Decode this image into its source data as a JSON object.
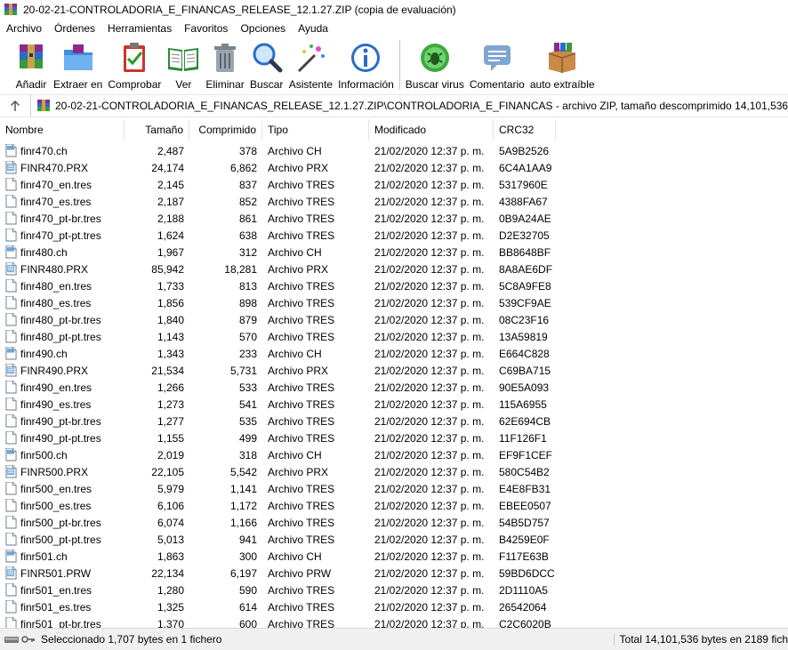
{
  "window": {
    "title": "20-02-21-CONTROLADORIA_E_FINANCAS_RELEASE_12.1.27.ZIP (copia de evaluación)"
  },
  "menu": [
    "Archivo",
    "Órdenes",
    "Herramientas",
    "Favoritos",
    "Opciones",
    "Ayuda"
  ],
  "toolbar": [
    {
      "label": "Añadir",
      "icon": "add-archive-icon"
    },
    {
      "label": "Extraer en",
      "icon": "extract-folder-icon"
    },
    {
      "label": "Comprobar",
      "icon": "test-clipboard-icon"
    },
    {
      "label": "Ver",
      "icon": "view-book-icon"
    },
    {
      "label": "Eliminar",
      "icon": "trash-icon"
    },
    {
      "label": "Buscar",
      "icon": "magnifier-icon"
    },
    {
      "label": "Asistente",
      "icon": "wizard-wand-icon"
    },
    {
      "label": "Información",
      "icon": "info-icon"
    },
    {
      "label": "Buscar virus",
      "icon": "virus-scan-icon"
    },
    {
      "label": "Comentario",
      "icon": "comment-icon"
    },
    {
      "label": "auto extraíble",
      "icon": "sfx-box-icon"
    }
  ],
  "address": {
    "path": "20-02-21-CONTROLADORIA_E_FINANCAS_RELEASE_12.1.27.ZIP\\CONTROLADORIA_E_FINANCAS - archivo ZIP, tamaño descomprimido 14,101,536 bytes"
  },
  "columns": {
    "name": "Nombre",
    "size": "Tamaño",
    "compressed": "Comprimido",
    "type": "Tipo",
    "modified": "Modificado",
    "crc": "CRC32"
  },
  "files": [
    {
      "name": "finr470.ch",
      "size": "2,487",
      "compressed": "378",
      "type": "Archivo CH",
      "modified": "21/02/2020 12:37 p. m.",
      "crc": "5A9B2526",
      "kind": "ch"
    },
    {
      "name": "FINR470.PRX",
      "size": "24,174",
      "compressed": "6,862",
      "type": "Archivo PRX",
      "modified": "21/02/2020 12:37 p. m.",
      "crc": "6C4A1AA9",
      "kind": "prx"
    },
    {
      "name": "finr470_en.tres",
      "size": "2,145",
      "compressed": "837",
      "type": "Archivo TRES",
      "modified": "21/02/2020 12:37 p. m.",
      "crc": "5317960E",
      "kind": "tres"
    },
    {
      "name": "finr470_es.tres",
      "size": "2,187",
      "compressed": "852",
      "type": "Archivo TRES",
      "modified": "21/02/2020 12:37 p. m.",
      "crc": "4388FA67",
      "kind": "tres"
    },
    {
      "name": "finr470_pt-br.tres",
      "size": "2,188",
      "compressed": "861",
      "type": "Archivo TRES",
      "modified": "21/02/2020 12:37 p. m.",
      "crc": "0B9A24AE",
      "kind": "tres"
    },
    {
      "name": "finr470_pt-pt.tres",
      "size": "1,624",
      "compressed": "638",
      "type": "Archivo TRES",
      "modified": "21/02/2020 12:37 p. m.",
      "crc": "D2E32705",
      "kind": "tres"
    },
    {
      "name": "finr480.ch",
      "size": "1,967",
      "compressed": "312",
      "type": "Archivo CH",
      "modified": "21/02/2020 12:37 p. m.",
      "crc": "BB8648BF",
      "kind": "ch"
    },
    {
      "name": "FINR480.PRX",
      "size": "85,942",
      "compressed": "18,281",
      "type": "Archivo PRX",
      "modified": "21/02/2020 12:37 p. m.",
      "crc": "8A8AE6DF",
      "kind": "prx"
    },
    {
      "name": "finr480_en.tres",
      "size": "1,733",
      "compressed": "813",
      "type": "Archivo TRES",
      "modified": "21/02/2020 12:37 p. m.",
      "crc": "5C8A9FE8",
      "kind": "tres"
    },
    {
      "name": "finr480_es.tres",
      "size": "1,856",
      "compressed": "898",
      "type": "Archivo TRES",
      "modified": "21/02/2020 12:37 p. m.",
      "crc": "539CF9AE",
      "kind": "tres"
    },
    {
      "name": "finr480_pt-br.tres",
      "size": "1,840",
      "compressed": "879",
      "type": "Archivo TRES",
      "modified": "21/02/2020 12:37 p. m.",
      "crc": "08C23F16",
      "kind": "tres"
    },
    {
      "name": "finr480_pt-pt.tres",
      "size": "1,143",
      "compressed": "570",
      "type": "Archivo TRES",
      "modified": "21/02/2020 12:37 p. m.",
      "crc": "13A59819",
      "kind": "tres"
    },
    {
      "name": "finr490.ch",
      "size": "1,343",
      "compressed": "233",
      "type": "Archivo CH",
      "modified": "21/02/2020 12:37 p. m.",
      "crc": "E664C828",
      "kind": "ch"
    },
    {
      "name": "FINR490.PRX",
      "size": "21,534",
      "compressed": "5,731",
      "type": "Archivo PRX",
      "modified": "21/02/2020 12:37 p. m.",
      "crc": "C69BA715",
      "kind": "prx"
    },
    {
      "name": "finr490_en.tres",
      "size": "1,266",
      "compressed": "533",
      "type": "Archivo TRES",
      "modified": "21/02/2020 12:37 p. m.",
      "crc": "90E5A093",
      "kind": "tres"
    },
    {
      "name": "finr490_es.tres",
      "size": "1,273",
      "compressed": "541",
      "type": "Archivo TRES",
      "modified": "21/02/2020 12:37 p. m.",
      "crc": "115A6955",
      "kind": "tres"
    },
    {
      "name": "finr490_pt-br.tres",
      "size": "1,277",
      "compressed": "535",
      "type": "Archivo TRES",
      "modified": "21/02/2020 12:37 p. m.",
      "crc": "62E694CB",
      "kind": "tres"
    },
    {
      "name": "finr490_pt-pt.tres",
      "size": "1,155",
      "compressed": "499",
      "type": "Archivo TRES",
      "modified": "21/02/2020 12:37 p. m.",
      "crc": "11F126F1",
      "kind": "tres"
    },
    {
      "name": "finr500.ch",
      "size": "2,019",
      "compressed": "318",
      "type": "Archivo CH",
      "modified": "21/02/2020 12:37 p. m.",
      "crc": "EF9F1CEF",
      "kind": "ch"
    },
    {
      "name": "FINR500.PRX",
      "size": "22,105",
      "compressed": "5,542",
      "type": "Archivo PRX",
      "modified": "21/02/2020 12:37 p. m.",
      "crc": "580C54B2",
      "kind": "prx"
    },
    {
      "name": "finr500_en.tres",
      "size": "5,979",
      "compressed": "1,141",
      "type": "Archivo TRES",
      "modified": "21/02/2020 12:37 p. m.",
      "crc": "E4E8FB31",
      "kind": "tres"
    },
    {
      "name": "finr500_es.tres",
      "size": "6,106",
      "compressed": "1,172",
      "type": "Archivo TRES",
      "modified": "21/02/2020 12:37 p. m.",
      "crc": "EBEE0507",
      "kind": "tres"
    },
    {
      "name": "finr500_pt-br.tres",
      "size": "6,074",
      "compressed": "1,166",
      "type": "Archivo TRES",
      "modified": "21/02/2020 12:37 p. m.",
      "crc": "54B5D757",
      "kind": "tres"
    },
    {
      "name": "finr500_pt-pt.tres",
      "size": "5,013",
      "compressed": "941",
      "type": "Archivo TRES",
      "modified": "21/02/2020 12:37 p. m.",
      "crc": "B4259E0F",
      "kind": "tres"
    },
    {
      "name": "finr501.ch",
      "size": "1,863",
      "compressed": "300",
      "type": "Archivo CH",
      "modified": "21/02/2020 12:37 p. m.",
      "crc": "F117E63B",
      "kind": "ch"
    },
    {
      "name": "FINR501.PRW",
      "size": "22,134",
      "compressed": "6,197",
      "type": "Archivo PRW",
      "modified": "21/02/2020 12:37 p. m.",
      "crc": "59BD6DCC",
      "kind": "prx"
    },
    {
      "name": "finr501_en.tres",
      "size": "1,280",
      "compressed": "590",
      "type": "Archivo TRES",
      "modified": "21/02/2020 12:37 p. m.",
      "crc": "2D1110A5",
      "kind": "tres"
    },
    {
      "name": "finr501_es.tres",
      "size": "1,325",
      "compressed": "614",
      "type": "Archivo TRES",
      "modified": "21/02/2020 12:37 p. m.",
      "crc": "26542064",
      "kind": "tres"
    },
    {
      "name": "finr501_pt-br.tres",
      "size": "1,370",
      "compressed": "600",
      "type": "Archivo TRES",
      "modified": "21/02/2020 12:37 p. m.",
      "crc": "C2C6020B",
      "kind": "tres"
    }
  ],
  "status": {
    "selected": "Seleccionado 1,707 bytes en 1 fichero",
    "total": "Total 14,101,536 bytes en 2189 fich"
  },
  "colors": {
    "accent_blue": "#1f6fbf",
    "header_divider": "#e5e5e5",
    "status_bg": "#f0f0f0"
  }
}
